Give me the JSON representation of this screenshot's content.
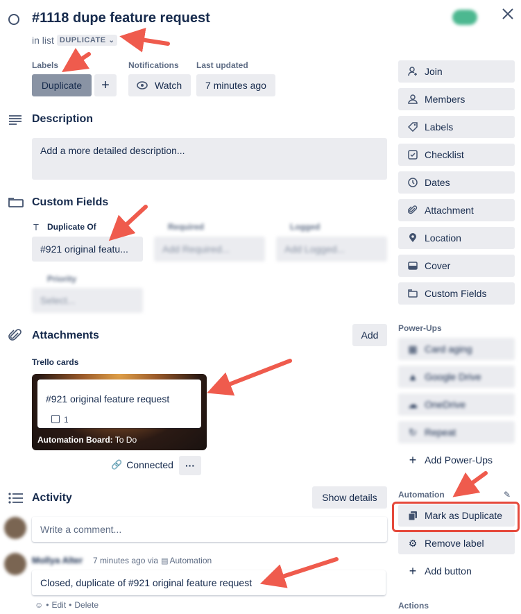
{
  "card": {
    "title": "#1118 dupe feature request",
    "in_list_prefix": "in list",
    "list_name": "DUPLICATE"
  },
  "labels": {
    "heading": "Labels",
    "chip": "Duplicate",
    "add": "+"
  },
  "notifications": {
    "heading": "Notifications",
    "watch": "Watch"
  },
  "last_updated": {
    "heading": "Last updated",
    "value": "7 minutes ago"
  },
  "description": {
    "heading": "Description",
    "placeholder": "Add a more detailed description..."
  },
  "custom_fields": {
    "heading": "Custom Fields",
    "fields": [
      {
        "label": "Duplicate Of",
        "value": "#921 original featu..."
      },
      {
        "label": "Required",
        "value": "Add Required..."
      },
      {
        "label": "Logged",
        "value": "Add Logged..."
      },
      {
        "label": "Priority",
        "value": "Select..."
      }
    ]
  },
  "attachments": {
    "heading": "Attachments",
    "add": "Add",
    "group": "Trello cards",
    "card_title": "#921 original feature request",
    "card_count": "1",
    "board": "Automation Board:",
    "list": "To Do",
    "connected": "Connected",
    "more": "···"
  },
  "activity": {
    "heading": "Activity",
    "show_details": "Show details",
    "comment_placeholder": "Write a comment...",
    "entry_author": "Mollya Alter",
    "entry_meta": "7 minutes ago via",
    "entry_via": "Automation",
    "entry_text": "Closed, duplicate of #921 original feature request",
    "edit": "Edit",
    "delete": "Delete",
    "sep": "•"
  },
  "sidebar": {
    "add_to_card": [
      "Join",
      "Members",
      "Labels",
      "Checklist",
      "Dates",
      "Attachment",
      "Location",
      "Cover",
      "Custom Fields"
    ],
    "powerups_heading": "Power-Ups",
    "powerups": [
      "Card aging",
      "Google Drive",
      "OneDrive",
      "Repeat"
    ],
    "add_powerups": "Add Power-Ups",
    "automation_heading": "Automation",
    "automation": [
      "Mark as Duplicate",
      "Remove label"
    ],
    "add_button": "Add button",
    "actions_heading": "Actions"
  },
  "colors": {
    "accent": "#ef5b4d",
    "highlight_border": "#e5493b",
    "label_chip": "#8993a4"
  }
}
